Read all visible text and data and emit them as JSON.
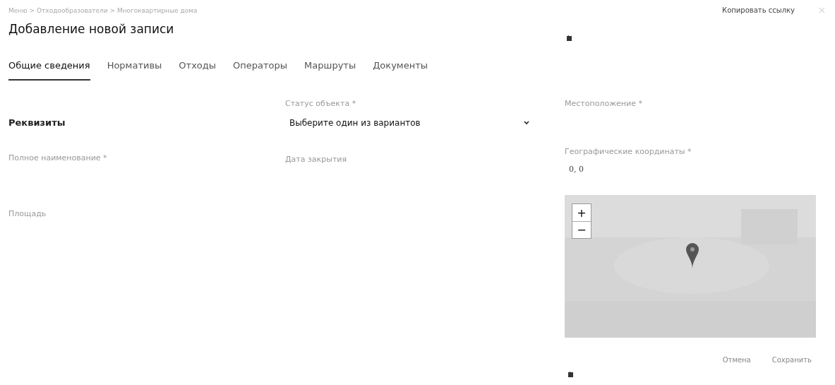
{
  "breadcrumb": "Меню  >  Отходообразователи  >  Многоквартирные дома",
  "copy_link": "Копировать ссылку",
  "title": "Добавление новой записи",
  "tabs": [
    {
      "label": "Общие сведения",
      "selected": true
    },
    {
      "label": "Нормативы",
      "selected": false
    },
    {
      "label": "Отходы",
      "selected": false
    },
    {
      "label": "Операторы",
      "selected": false
    },
    {
      "label": "Маршруты",
      "selected": false
    },
    {
      "label": "Документы",
      "selected": false
    }
  ],
  "section": "Реквизиты",
  "fields": {
    "full_name": "Полное наименование *",
    "area": "Площадь",
    "status": {
      "label": "Статус объекта *",
      "placeholder": "Выберите один из вариантов"
    },
    "closing_date": "Дата закрытия",
    "location": "Местоположение *",
    "coordinates": {
      "label": "Географические координаты *",
      "value": "0, 0"
    }
  },
  "map": {
    "zoom_in": "+",
    "zoom_out": "−"
  },
  "buttons": [
    "Отмена",
    "Сохранить"
  ]
}
